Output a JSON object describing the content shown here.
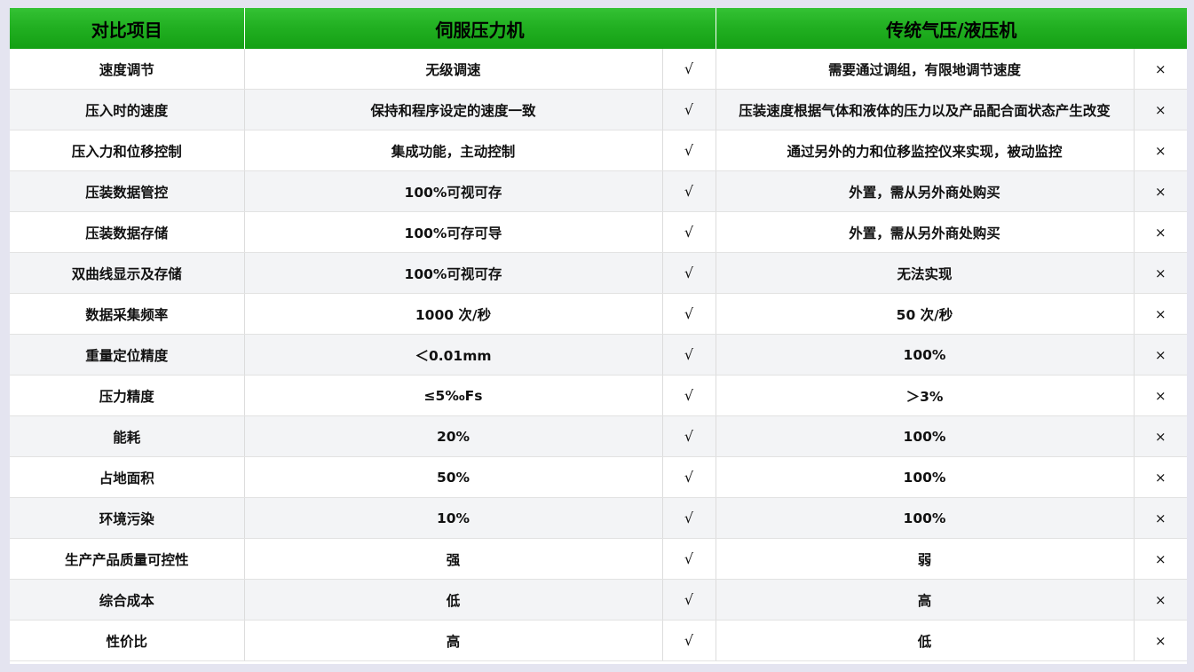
{
  "header": {
    "item": "对比项目",
    "servo": "伺服压力机",
    "traditional": "传统气压/液压机"
  },
  "rows": [
    {
      "item": "速度调节",
      "servo": "无级调速",
      "servo_mark": "√",
      "traditional": "需要通过调组，有限地调节速度",
      "traditional_mark": "×"
    },
    {
      "item": "压入时的速度",
      "servo": "保持和程序设定的速度一致",
      "servo_mark": "√",
      "traditional": "压装速度根据气体和液体的压力以及产品配合面状态产生改变",
      "traditional_mark": "×"
    },
    {
      "item": "压入力和位移控制",
      "servo": "集成功能，主动控制",
      "servo_mark": "√",
      "traditional": "通过另外的力和位移监控仪来实现，被动监控",
      "traditional_mark": "×"
    },
    {
      "item": "压装数据管控",
      "servo": "100%可视可存",
      "servo_mark": "√",
      "traditional": "外置，需从另外商处购买",
      "traditional_mark": "×"
    },
    {
      "item": "压装数据存储",
      "servo": "100%可存可导",
      "servo_mark": "√",
      "traditional": "外置，需从另外商处购买",
      "traditional_mark": "×"
    },
    {
      "item": "双曲线显示及存储",
      "servo": "100%可视可存",
      "servo_mark": "√",
      "traditional": "无法实现",
      "traditional_mark": "×"
    },
    {
      "item": "数据采集频率",
      "servo": "1000 次/秒",
      "servo_mark": "√",
      "traditional": "50 次/秒",
      "traditional_mark": "×"
    },
    {
      "item": "重量定位精度",
      "servo": "＜0.01mm",
      "servo_mark": "√",
      "traditional": "100%",
      "traditional_mark": "×"
    },
    {
      "item": "压力精度",
      "servo": "≤5‰Fs",
      "servo_mark": "√",
      "traditional": "＞3%",
      "traditional_mark": "×"
    },
    {
      "item": "能耗",
      "servo": "20%",
      "servo_mark": "√",
      "traditional": "100%",
      "traditional_mark": "×"
    },
    {
      "item": "占地面积",
      "servo": "50%",
      "servo_mark": "√",
      "traditional": "100%",
      "traditional_mark": "×"
    },
    {
      "item": "环境污染",
      "servo": "10%",
      "servo_mark": "√",
      "traditional": "100%",
      "traditional_mark": "×"
    },
    {
      "item": "生产产品质量可控性",
      "servo": "强",
      "servo_mark": "√",
      "traditional": "弱",
      "traditional_mark": "×"
    },
    {
      "item": "综合成本",
      "servo": "低",
      "servo_mark": "√",
      "traditional": "高",
      "traditional_mark": "×"
    },
    {
      "item": "性价比",
      "servo": "高",
      "servo_mark": "√",
      "traditional": "低",
      "traditional_mark": "×"
    }
  ]
}
